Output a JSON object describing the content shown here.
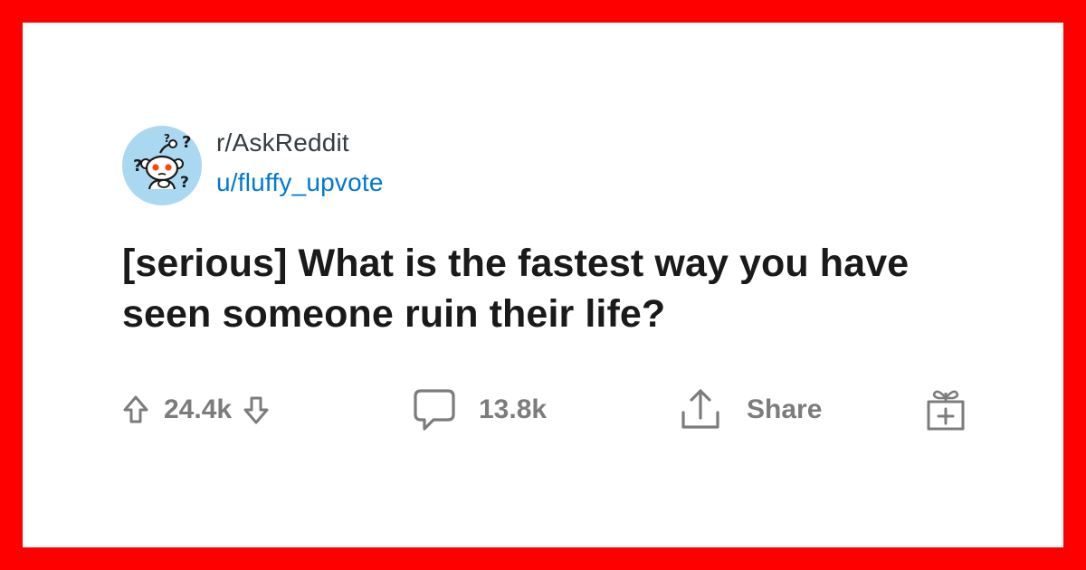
{
  "post": {
    "subreddit": "r/AskReddit",
    "author": "u/fluffy_upvote",
    "title": "[serious] What is the fastest way you have seen someone ruin their life?"
  },
  "actions": {
    "upvote_icon": "arrow-up-outline-icon",
    "vote_count": "24.4k",
    "downvote_icon": "arrow-down-outline-icon",
    "comment_icon": "speech-bubble-icon",
    "comment_count": "13.8k",
    "share_icon": "upload-arrow-icon",
    "share_label": "Share",
    "award_icon": "gift-box-icon"
  },
  "colors": {
    "frame": "#ff0000",
    "card": "#ffffff",
    "title": "#1a1a1b",
    "subreddit": "#333d42",
    "author": "#0079d3",
    "action_gray": "#7c7c7c",
    "avatar_bg": "#a9d8f0"
  }
}
